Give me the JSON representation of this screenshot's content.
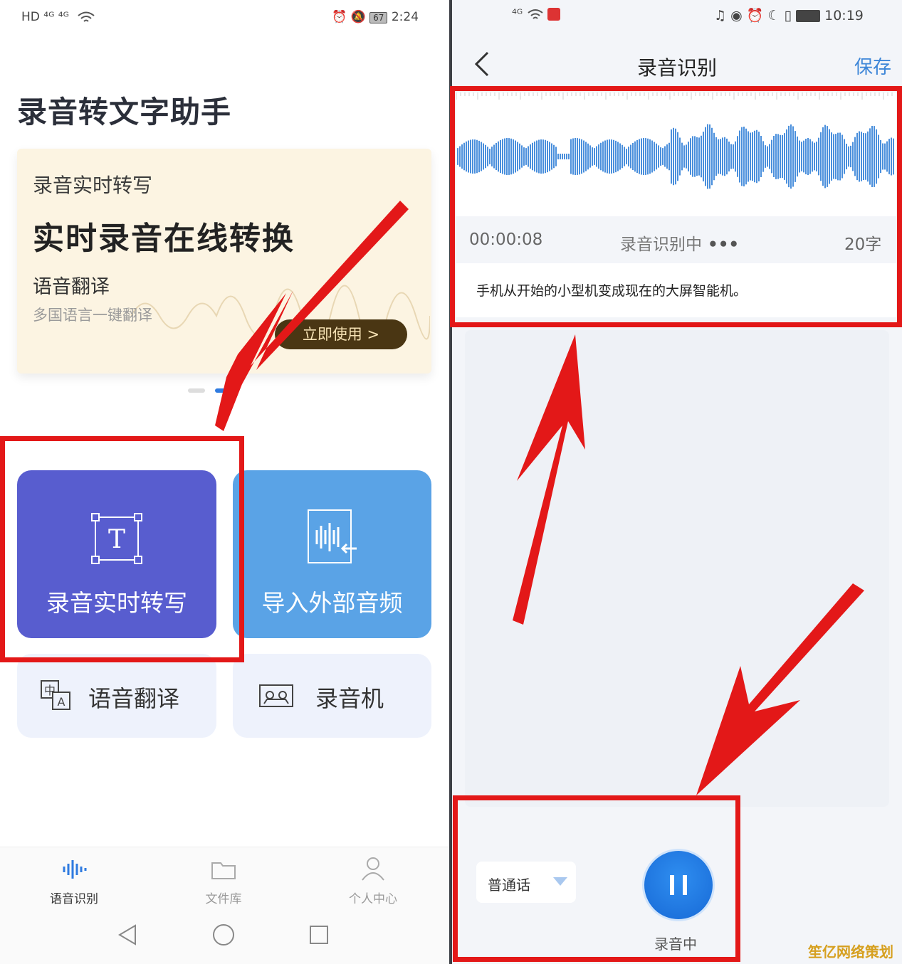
{
  "left_phone": {
    "status_bar": {
      "left_icons": "HD ⁴ᴳ ⁴ᴳ",
      "battery": "67",
      "time": "2:24"
    },
    "app_title": "录音转文字助手",
    "banner": {
      "subtitle": "录音实时转写",
      "title": "实时录音在线转换",
      "line3": "语音翻译",
      "line4": "多国语言一键翻译",
      "button": "立即使用 >"
    },
    "cards": [
      {
        "label": "录音实时转写",
        "icon": "text-frame-icon",
        "color": "#585dcf"
      },
      {
        "label": "导入外部音频",
        "icon": "import-audio-icon",
        "color": "#5aa3e6"
      }
    ],
    "small_cards": [
      {
        "label": "语音翻译",
        "icon": "translate-icon"
      },
      {
        "label": "录音机",
        "icon": "cassette-icon"
      }
    ],
    "tabs": [
      {
        "label": "语音识别",
        "icon": "waveform-icon",
        "active": true
      },
      {
        "label": "文件库",
        "icon": "folder-icon",
        "active": false
      },
      {
        "label": "个人中心",
        "icon": "person-icon",
        "active": false
      }
    ]
  },
  "right_phone": {
    "status_bar": {
      "left_icons": "⁴ᴳ",
      "time": "10:19"
    },
    "title": "录音识别",
    "save": "保存",
    "time": "00:00:08",
    "status": "录音识别中",
    "count": "20字",
    "transcript": "手机从开始的小型机变成现在的大屏智能机。",
    "language": "普通话",
    "rec_label": "录音中",
    "accent": "#3d86d8"
  },
  "annotation_color": "#e31818",
  "watermark": "笙亿网络策划"
}
